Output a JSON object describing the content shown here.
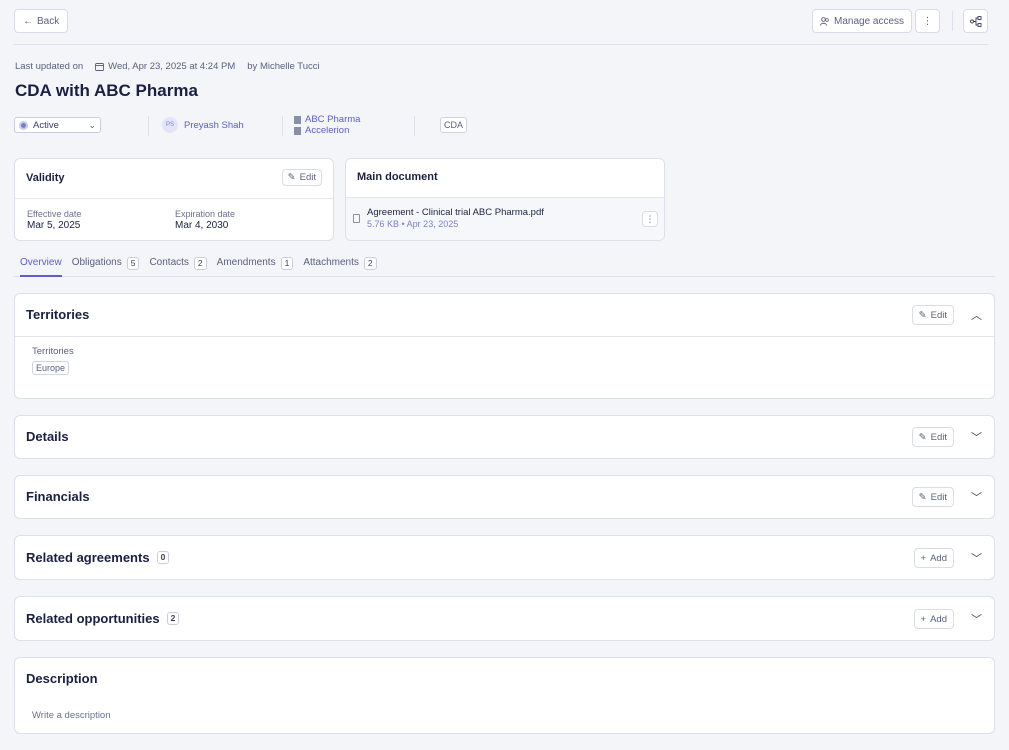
{
  "toolbar": {
    "back_label": "Back",
    "manage_access_label": "Manage access"
  },
  "meta": {
    "updated_prefix": "Last updated on",
    "updated_date": "Wed, Apr 23, 2025 at 4:24 PM",
    "updated_by": "by Michelle Tucci"
  },
  "title": "CDA with ABC Pharma",
  "status": {
    "value": "Active"
  },
  "owner": {
    "initials": "PS",
    "name": "Preyash Shah"
  },
  "companies": [
    "ABC Pharma",
    "Accelerion"
  ],
  "type_tag": "CDA",
  "validity": {
    "title": "Validity",
    "edit_label": "Edit",
    "effective_label": "Effective date",
    "effective_value": "Mar 5, 2025",
    "expiration_label": "Expiration date",
    "expiration_value": "Mar 4, 2030"
  },
  "main_document": {
    "title": "Main document",
    "file_name": "Agreement - Clinical trial ABC Pharma.pdf",
    "file_meta": "5.76 KB • Apr 23, 2025"
  },
  "tabs": [
    {
      "label": "Overview",
      "count": null
    },
    {
      "label": "Obligations",
      "count": "5"
    },
    {
      "label": "Contacts",
      "count": "2"
    },
    {
      "label": "Amendments",
      "count": "1"
    },
    {
      "label": "Attachments",
      "count": "2"
    }
  ],
  "sections": {
    "territories": {
      "title": "Territories",
      "button": "Edit",
      "field_label": "Territories",
      "tag": "Europe"
    },
    "details": {
      "title": "Details",
      "button": "Edit"
    },
    "financials": {
      "title": "Financials",
      "button": "Edit"
    },
    "related_agreements": {
      "title": "Related agreements",
      "count": "0",
      "button": "Add"
    },
    "related_opportunities": {
      "title": "Related opportunities",
      "count": "2",
      "button": "Add"
    },
    "description": {
      "title": "Description",
      "placeholder": "Write a description"
    }
  },
  "colors": {
    "accent": "#5b5fc7",
    "background": "#f4f5f9",
    "text": "#1a1f44"
  }
}
